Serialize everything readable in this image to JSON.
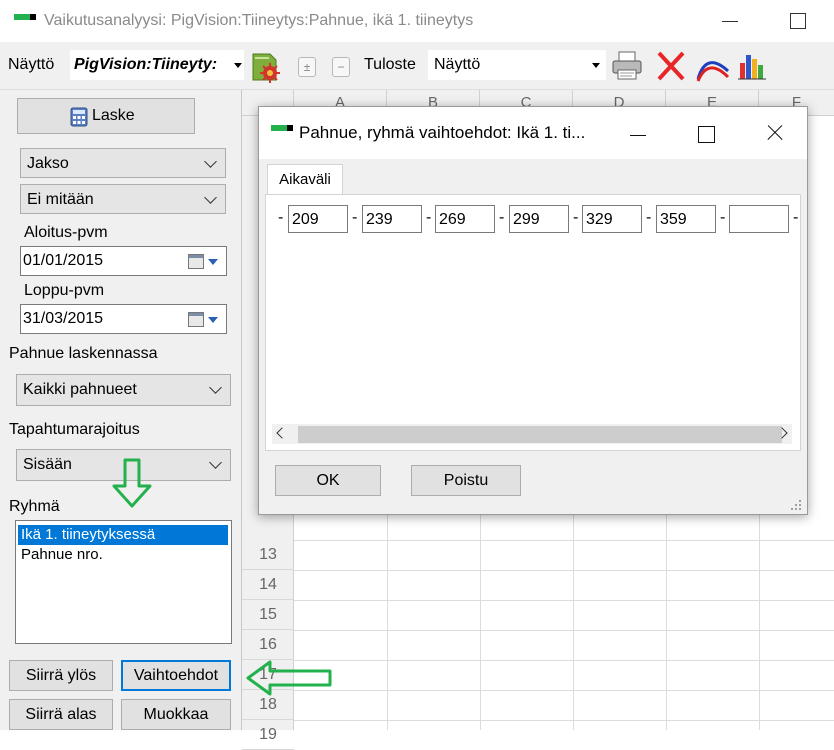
{
  "window": {
    "title": "Vaikutusanalyysi: PigVision:Tiineytys:Pahnue, ikä 1. tiineytys"
  },
  "toolbar": {
    "view_label": "Näyttö",
    "report_combo_value": "PigVision:Tiineyty:",
    "print_label": "Tuloste",
    "view_combo_value": "Näyttö"
  },
  "left_panel": {
    "calculate_button": "Laske",
    "period_combo": "Jakso",
    "none_combo": "Ei mitään",
    "start_date_label": "Aloitus-pvm",
    "start_date_value": "01/01/2015",
    "end_date_label": "Loppu-pvm",
    "end_date_value": "31/03/2015",
    "litters_label": "Pahnue laskennassa",
    "litters_combo": "Kaikki pahnueet",
    "event_limit_label": "Tapahtumarajoitus",
    "event_limit_combo": "Sisään",
    "group_label": "Ryhmä",
    "group_items": [
      "Ikä 1. tiineytyksessä",
      "Pahnue nro."
    ],
    "move_up_button": "Siirrä ylös",
    "options_button": "Vaihtoehdot",
    "move_down_button": "Siirrä alas",
    "edit_button": "Muokkaa"
  },
  "grid": {
    "columns": [
      "A",
      "B",
      "C",
      "D",
      "E",
      "F"
    ],
    "rows": [
      "13",
      "14",
      "15",
      "16",
      "17",
      "18",
      "19"
    ]
  },
  "dialog": {
    "title": "Pahnue, ryhmä vaihtoehdot: Ikä 1. ti...",
    "tab_label": "Aikaväli",
    "range_values": [
      "209",
      "239",
      "269",
      "299",
      "329",
      "359",
      ""
    ],
    "separator": "-",
    "ok_button": "OK",
    "exit_button": "Poistu"
  },
  "colors": {
    "selection": "#0078d7",
    "annotation_arrow": "#22b14c",
    "close_red": "#e8262a"
  }
}
